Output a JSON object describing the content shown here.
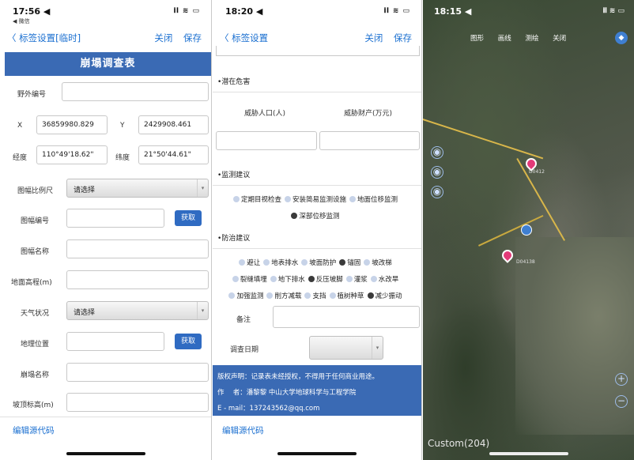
{
  "phone1": {
    "status": {
      "time": "17:56 ◀",
      "sub": "◀ 微信",
      "icons": "𝐢𝐥 ≋ ▭"
    },
    "nav": {
      "back": "〈 标签设置[临时]",
      "close": "关闭",
      "save": "保存"
    },
    "banner": "崩塌调查表",
    "fields": {
      "field_no": {
        "label": "野外编号",
        "value": ""
      },
      "x": {
        "label": "X",
        "value": "36859980.829"
      },
      "y": {
        "label": "Y",
        "value": "2429908.461"
      },
      "lon": {
        "label": "经度",
        "value": "110°49'18.62\""
      },
      "lat": {
        "label": "纬度",
        "value": "21°50'44.61\""
      },
      "scale": {
        "label": "图幅比例尺",
        "value": "请选择"
      },
      "sheet_no": {
        "label": "图幅编号",
        "value": "",
        "button": "获取"
      },
      "sheet_name": {
        "label": "图幅名称",
        "value": ""
      },
      "elevation": {
        "label": "地面高程(m)",
        "value": ""
      },
      "weather": {
        "label": "天气状况",
        "value": "请选择"
      },
      "location": {
        "label": "地理位置",
        "value": "",
        "button": "获取"
      },
      "name": {
        "label": "崩塌名称",
        "value": ""
      },
      "top_elev": {
        "label": "坡顶标高(m)",
        "value": ""
      }
    },
    "edit_source": "编辑源代码"
  },
  "phone2": {
    "status": {
      "time": "18:20 ◀",
      "icons": "𝐢𝐥 ≋ ▭"
    },
    "nav": {
      "back": "〈 标签设置",
      "close": "关闭",
      "save": "保存"
    },
    "hazard": {
      "title": "•潜在危害",
      "col1": "威胁人口(人)",
      "col2": "威胁财产(万元)"
    },
    "monitor": {
      "title": "•监测建议",
      "options": [
        {
          "label": "定期目视检查",
          "checked": false
        },
        {
          "label": "安装简易监测设施",
          "checked": false
        },
        {
          "label": "地面位移监测",
          "checked": false
        },
        {
          "label": "深部位移监测",
          "checked": true
        }
      ]
    },
    "prevent": {
      "title": "•防治建议",
      "options": [
        {
          "label": "避让",
          "checked": false
        },
        {
          "label": "地表排水",
          "checked": false
        },
        {
          "label": "坡面防护",
          "checked": false
        },
        {
          "label": "锚固",
          "checked": true
        },
        {
          "label": "坡改梯",
          "checked": false
        },
        {
          "label": "裂缝填埋",
          "checked": false
        },
        {
          "label": "地下排水",
          "checked": false
        },
        {
          "label": "反压坡脚",
          "checked": true
        },
        {
          "label": "灌浆",
          "checked": false
        },
        {
          "label": "水改旱",
          "checked": false
        },
        {
          "label": "加强监测",
          "checked": false
        },
        {
          "label": "削方减载",
          "checked": false
        },
        {
          "label": "支挡",
          "checked": false
        },
        {
          "label": "植树种草",
          "checked": false
        },
        {
          "label": "减少振动",
          "checked": true
        }
      ]
    },
    "remark": {
      "label": "备注",
      "value": ""
    },
    "survey_date": {
      "label": "调查日期",
      "value": ""
    },
    "copyright": {
      "line1": "版权声明：记录表未经授权，不得用于任何商业用途。",
      "line2": "作　 者：潘黎黎  中山大学地球科学与工程学院",
      "line3": "E - mail：137243562@qq.com"
    },
    "edit_source": "编辑源代码"
  },
  "phone3": {
    "status": {
      "time": "18:15 ◀",
      "icons": "𝐢𝐥 ≋ ▭"
    },
    "tabs": [
      "图形",
      "画线",
      "测绘",
      "关闭"
    ],
    "labels": [
      "D0412",
      "D04138"
    ],
    "zoom_in": "+",
    "zoom_out": "−",
    "watermark": "Custom(204)"
  }
}
